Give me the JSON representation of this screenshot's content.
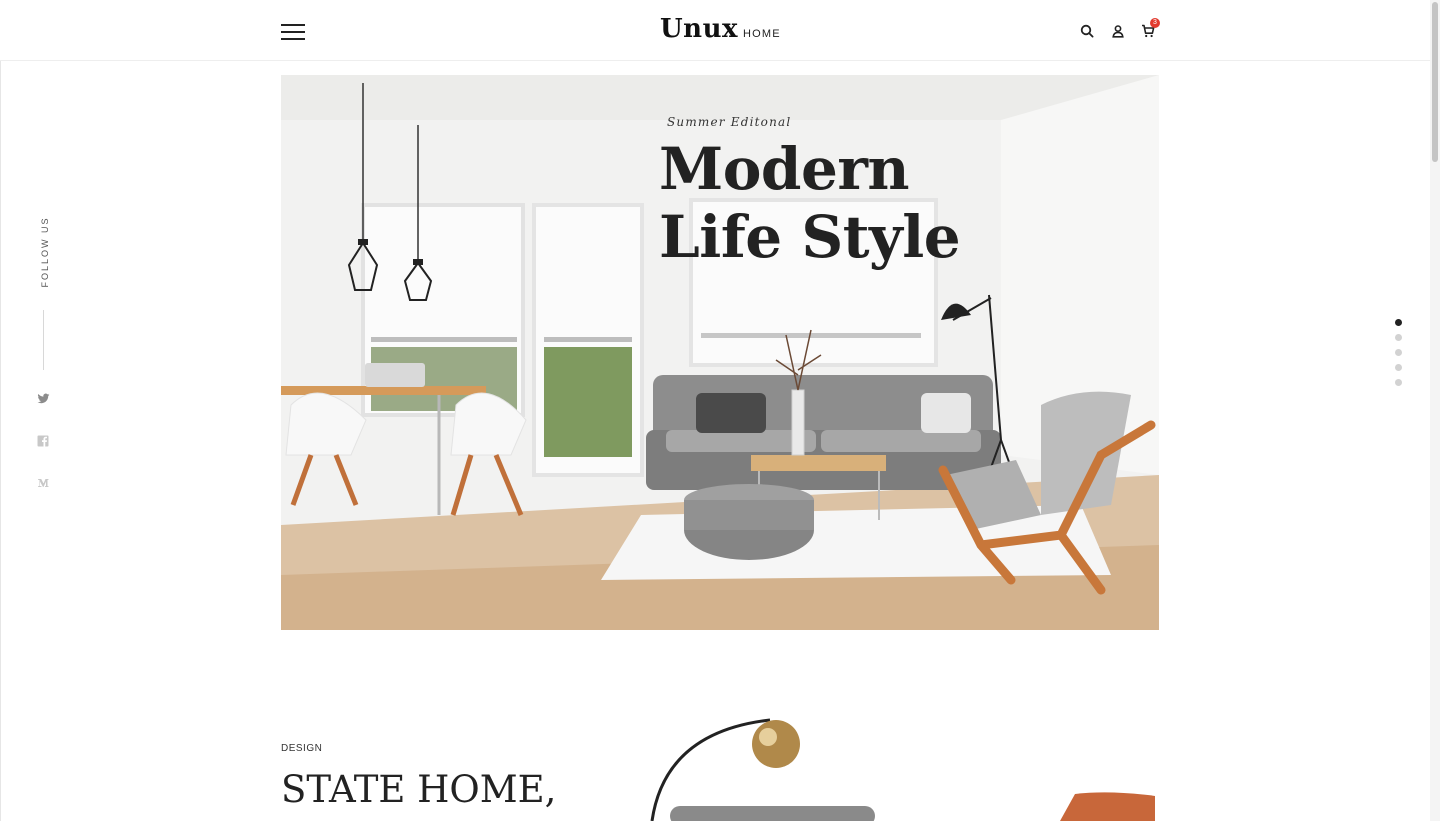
{
  "header": {
    "logo_main": "Unux",
    "logo_sub": "HOME",
    "cart_count": "3",
    "icons": [
      "menu-icon",
      "search-icon",
      "user-icon",
      "cart-icon"
    ]
  },
  "sidebar": {
    "follow_label": "FOLLOW US",
    "social_icons": [
      "twitter-icon",
      "facebook-icon",
      "medium-icon"
    ]
  },
  "hero": {
    "kicker": "Summer Editonal",
    "title_line1": "Modern",
    "title_line2": "Life Style",
    "slides_total": 5,
    "active_slide": 1
  },
  "section": {
    "kicker": "DESIGN",
    "title": "STATE HOME,"
  },
  "colors": {
    "badge": "#e23a2e",
    "text": "#222222",
    "dot_active": "#222222",
    "dot_inactive": "#d2d2d2",
    "accent_wood": "#c8773a"
  }
}
